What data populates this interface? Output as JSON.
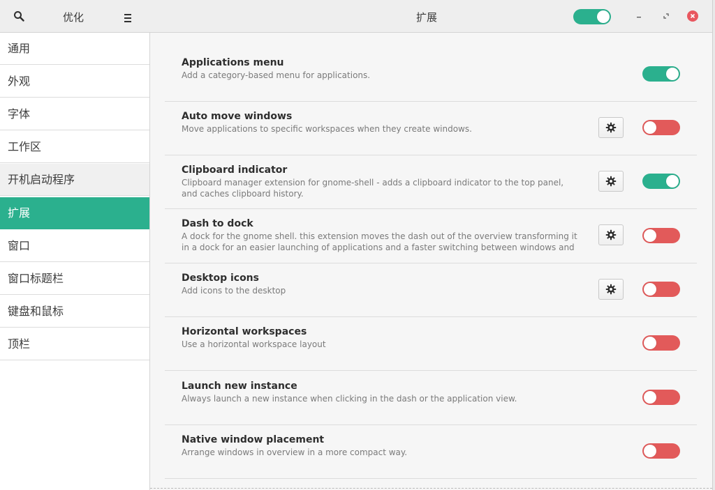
{
  "header": {
    "app_title": "优化",
    "page_title": "扩展",
    "global_switch_on": true
  },
  "sidebar": {
    "items": [
      {
        "label": "通用",
        "state": "normal"
      },
      {
        "label": "外观",
        "state": "normal"
      },
      {
        "label": "字体",
        "state": "normal"
      },
      {
        "label": "工作区",
        "state": "normal"
      },
      {
        "label": "开机启动程序",
        "state": "hover"
      },
      {
        "label": "扩展",
        "state": "active"
      },
      {
        "label": "窗口",
        "state": "normal"
      },
      {
        "label": "窗口标题栏",
        "state": "normal"
      },
      {
        "label": "键盘和鼠标",
        "state": "normal"
      },
      {
        "label": "顶栏",
        "state": "normal"
      }
    ]
  },
  "extensions": [
    {
      "title": "Applications menu",
      "desc": "Add a category-based menu for applications.",
      "has_settings": false,
      "enabled": true
    },
    {
      "title": "Auto move windows",
      "desc": "Move applications to specific workspaces when they create windows.",
      "has_settings": true,
      "enabled": false
    },
    {
      "title": "Clipboard indicator",
      "desc": "Clipboard manager extension for gnome-shell - adds a clipboard indicator to the top panel, and caches clipboard history.",
      "has_settings": true,
      "enabled": true
    },
    {
      "title": "Dash to dock",
      "desc": "A dock for the gnome shell. this extension moves the dash out of the overview transforming it in a dock for an easier launching of applications and a faster switching between windows and d…",
      "has_settings": true,
      "enabled": false
    },
    {
      "title": "Desktop icons",
      "desc": "Add icons to the desktop",
      "has_settings": true,
      "enabled": false
    },
    {
      "title": "Horizontal workspaces",
      "desc": "Use a horizontal workspace layout",
      "has_settings": false,
      "enabled": false
    },
    {
      "title": "Launch new instance",
      "desc": "Always launch a new instance when clicking in the dash or the application view.",
      "has_settings": false,
      "enabled": false
    },
    {
      "title": "Native window placement",
      "desc": "Arrange windows in overview in a more compact way.",
      "has_settings": false,
      "enabled": false
    }
  ],
  "colors": {
    "accent": "#2bb08e",
    "off": "#e25a5a",
    "close": "#e8575f"
  },
  "icons": {
    "search": "search-icon",
    "menu": "hamburger-menu-icon",
    "minimize": "minimize-icon",
    "maximize": "maximize-icon",
    "close": "close-icon",
    "settings": "gear-icon"
  }
}
